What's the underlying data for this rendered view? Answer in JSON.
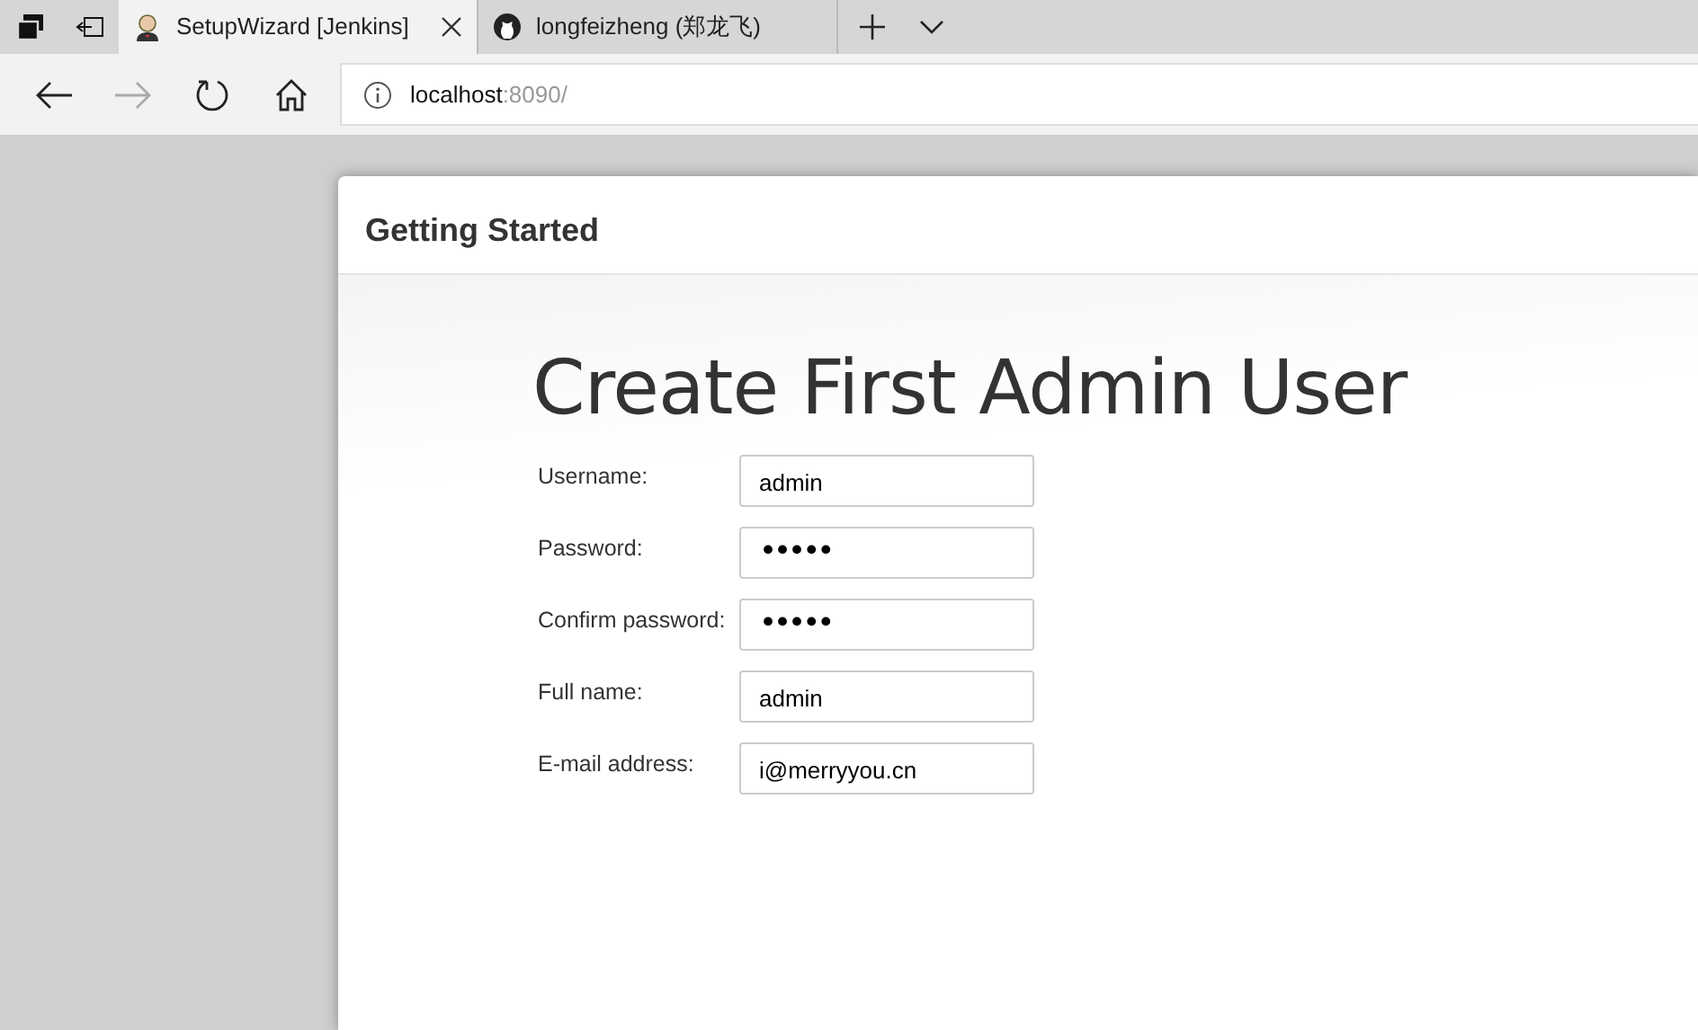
{
  "browser": {
    "tabs": [
      {
        "title": "SetupWizard [Jenkins]",
        "selected": true,
        "kind": "avatar"
      },
      {
        "title": "longfeizheng (郑龙飞)",
        "selected": false,
        "kind": "github"
      }
    ],
    "address": {
      "host": "localhost",
      "rest": ":8090/"
    }
  },
  "page": {
    "header": "Getting Started",
    "heading": "Create First Admin User",
    "fields": [
      {
        "label": "Username:",
        "value": "admin"
      },
      {
        "label": "Password:",
        "value": "•••••",
        "kind": "password"
      },
      {
        "label": "Confirm password:",
        "value": "•••••",
        "kind": "password"
      },
      {
        "label": "Full name:",
        "value": "admin"
      },
      {
        "label": "E-mail address:",
        "value": "i@merryyou.cn"
      }
    ]
  }
}
